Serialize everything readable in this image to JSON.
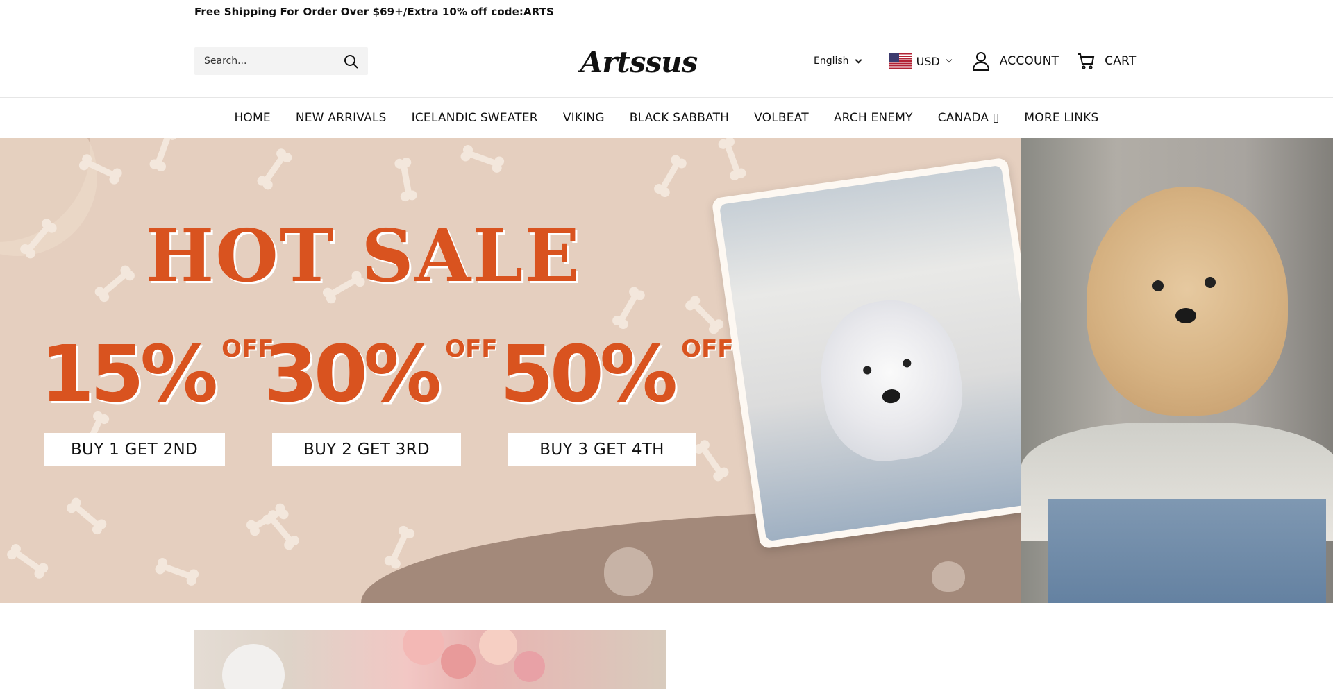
{
  "announcement": {
    "text": "Free Shipping For Order Over $69+/Extra 10% off code:ARTS"
  },
  "header": {
    "search_placeholder": "Search...",
    "logo_text": "Artssus",
    "language": "English",
    "currency": "USD",
    "account_label": "ACCOUNT",
    "cart_label": "CART"
  },
  "nav": {
    "items": [
      {
        "label": "HOME"
      },
      {
        "label": "NEW ARRIVALS"
      },
      {
        "label": "ICELANDIC SWEATER"
      },
      {
        "label": "VIKING"
      },
      {
        "label": "BLACK SABBATH"
      },
      {
        "label": "VOLBEAT"
      },
      {
        "label": "ARCH ENEMY"
      },
      {
        "label": "CANADA ▯"
      },
      {
        "label": "MORE LINKS"
      }
    ]
  },
  "hero": {
    "headline": "HOT SALE",
    "offers": [
      {
        "percent": "15%",
        "off": "OFF",
        "deal": "BUY 1 GET 2ND"
      },
      {
        "percent": "30%",
        "off": "OFF",
        "deal": "BUY 2 GET 3RD"
      },
      {
        "percent": "50%",
        "off": "OFF",
        "deal": "BUY 3 GET 4TH"
      }
    ],
    "colors": {
      "background": "#e5cfbf",
      "accent": "#d9531f",
      "wave": "#a3897a"
    }
  },
  "icons": [
    "search-icon",
    "chevron-down-icon",
    "us-flag-icon",
    "user-icon",
    "cart-icon"
  ]
}
